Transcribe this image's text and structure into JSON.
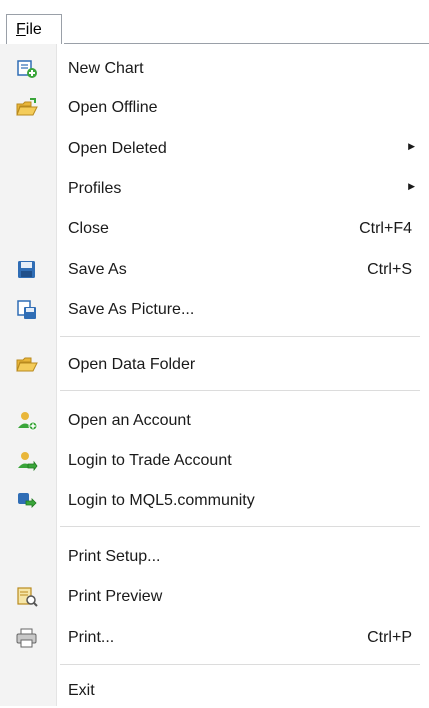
{
  "menubar": {
    "file_label_accel": "F",
    "file_label_rest": "ile"
  },
  "menu": {
    "items": [
      {
        "label": "New Chart",
        "icon": "new-chart-icon"
      },
      {
        "label": "Open Offline",
        "icon": "open-folder-icon"
      },
      {
        "label": "Open Deleted",
        "submenu": true
      },
      {
        "label": "Profiles",
        "submenu": true
      },
      {
        "label": "Close",
        "shortcut": "Ctrl+F4"
      },
      {
        "label": "Save As",
        "shortcut": "Ctrl+S",
        "icon": "floppy-disk-icon"
      },
      {
        "label": "Save As Picture...",
        "icon": "save-picture-icon"
      },
      {
        "label": "Open Data Folder",
        "icon": "folder-icon"
      },
      {
        "label": "Open an Account",
        "icon": "user-add-icon"
      },
      {
        "label": "Login to Trade Account",
        "icon": "user-login-icon"
      },
      {
        "label": "Login to MQL5.community",
        "icon": "mql5-login-icon"
      },
      {
        "label": "Print Setup..."
      },
      {
        "label": "Print Preview",
        "icon": "print-preview-icon"
      },
      {
        "label": "Print...",
        "shortcut": "Ctrl+P",
        "icon": "printer-icon"
      },
      {
        "label": "Exit"
      }
    ]
  },
  "colors": {
    "gutter": "#f3f3f3",
    "separator": "#dcdcdc",
    "accent_blue": "#2f6db5",
    "accent_green": "#3aa53a",
    "folder_yellow": "#e9b63a"
  }
}
